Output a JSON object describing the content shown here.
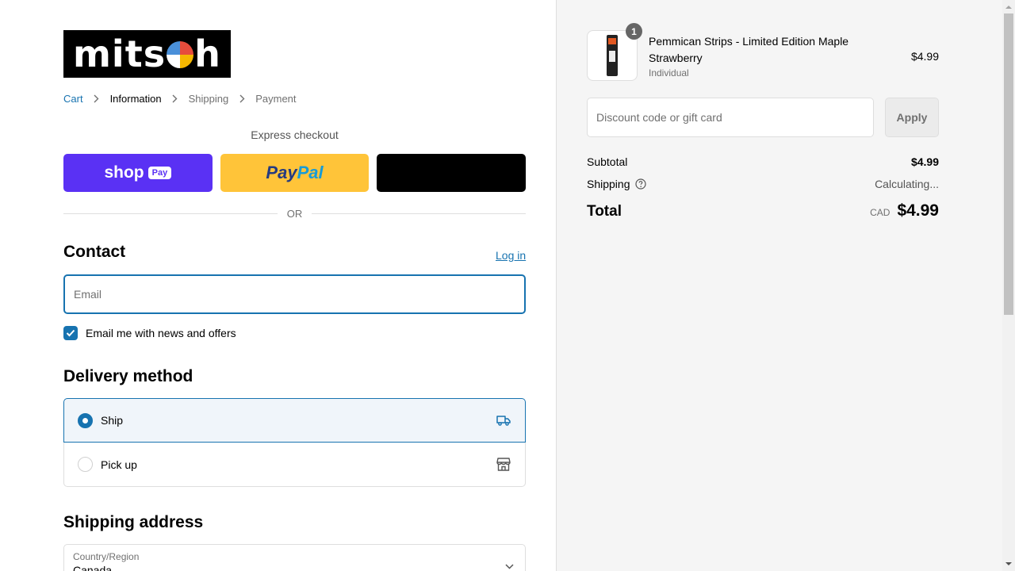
{
  "brand": {
    "logo_text_left": "mits",
    "logo_text_right": "h"
  },
  "breadcrumb": {
    "cart": "Cart",
    "information": "Information",
    "shipping": "Shipping",
    "payment": "Payment"
  },
  "express": {
    "title": "Express checkout",
    "shop_label": "shop",
    "shop_pill": "Pay",
    "paypal_left": "Pay",
    "paypal_right": "Pal",
    "or": "OR"
  },
  "contact": {
    "heading": "Contact",
    "login": "Log in",
    "email_placeholder": "Email",
    "news_label": "Email me with news and offers",
    "news_checked": true
  },
  "delivery": {
    "heading": "Delivery method",
    "options": [
      {
        "label": "Ship",
        "selected": true,
        "icon": "truck-icon"
      },
      {
        "label": "Pick up",
        "selected": false,
        "icon": "store-icon"
      }
    ]
  },
  "shipping_address": {
    "heading": "Shipping address",
    "country_label": "Country/Region",
    "country_value": "Canada"
  },
  "order": {
    "item": {
      "quantity": "1",
      "name": "Pemmican Strips - Limited Edition Maple Strawberry",
      "variant": "Individual",
      "price": "$4.99"
    },
    "discount_placeholder": "Discount code or gift card",
    "apply": "Apply",
    "subtotal_label": "Subtotal",
    "subtotal_value": "$4.99",
    "shipping_label": "Shipping",
    "shipping_value": "Calculating...",
    "total_label": "Total",
    "total_currency": "CAD",
    "total_value": "$4.99"
  },
  "colors": {
    "accent": "#1773b0",
    "shop_pay": "#5a31f4",
    "paypal": "#ffc439",
    "sidebar_bg": "#f5f5f5"
  }
}
